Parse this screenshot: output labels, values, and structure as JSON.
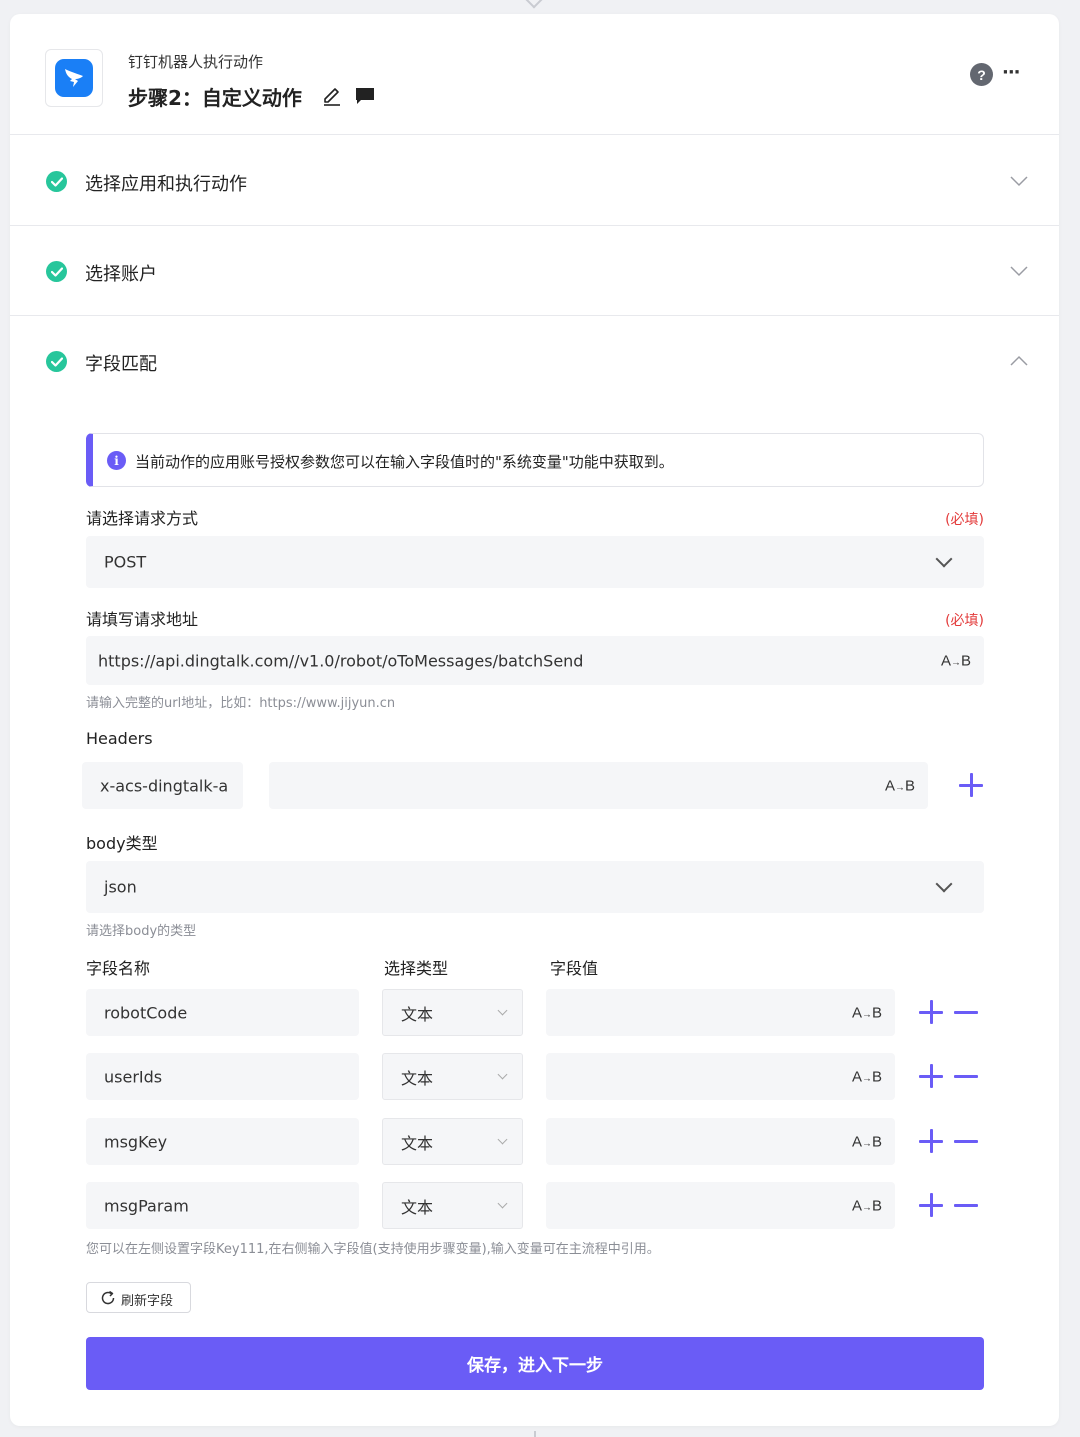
{
  "header": {
    "app_name": "钉钉机器人执行动作",
    "step_title": "步骤2：自定义动作",
    "help_glyph": "?",
    "more_glyph": "···"
  },
  "sections": [
    {
      "title": "选择应用和执行动作",
      "state": "collapsed",
      "status": "complete"
    },
    {
      "title": "选择账户",
      "state": "collapsed",
      "status": "complete"
    },
    {
      "title": "字段匹配",
      "state": "expanded",
      "status": "complete"
    }
  ],
  "info": {
    "icon_glyph": "i",
    "text": "当前动作的应用账号授权参数您可以在输入字段值时的\"系统变量\"功能中获取到。"
  },
  "request_method": {
    "label": "请选择请求方式",
    "required": "(必填)",
    "value": "POST"
  },
  "request_url": {
    "label": "请填写请求地址",
    "required": "(必填)",
    "value": "https://api.dingtalk.com//v1.0/robot/oToMessages/batchSend",
    "hint": "请输入完整的url地址，比如：https://www.jijyun.cn"
  },
  "headers": {
    "label": "Headers",
    "key_value": "x-acs-dingtalk-a",
    "value": ""
  },
  "body_type": {
    "label": "body类型",
    "value": "json",
    "hint": "请选择body的类型"
  },
  "fields_table": {
    "col_name": "字段名称",
    "col_type": "选择类型",
    "col_value": "字段值",
    "rows": [
      {
        "name": "robotCode",
        "type": "文本",
        "value": ""
      },
      {
        "name": "userIds",
        "type": "文本",
        "value": ""
      },
      {
        "name": "msgKey",
        "type": "文本",
        "value": ""
      },
      {
        "name": "msgParam",
        "type": "文本",
        "value": ""
      }
    ],
    "hint": "您可以在左侧设置字段Key111,在右侧输入字段值(支持使用步骤变量),输入变量可在主流程中引用。"
  },
  "variable_btn": {
    "a": "A",
    "arrow": "→",
    "b": "B"
  },
  "refresh_label": "刷新字段",
  "save_label": "保存，进入下一步",
  "colors": {
    "accent": "#6a5cf6",
    "success": "#27c69b",
    "required": "#e33a3a",
    "brand_dingtalk": "#1a7ff6"
  }
}
